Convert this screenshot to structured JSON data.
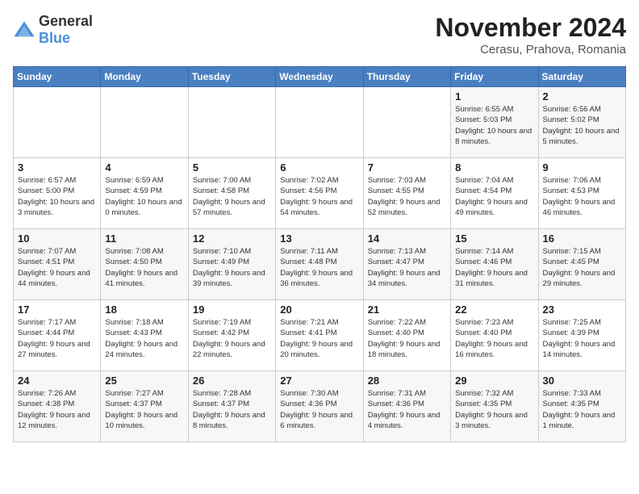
{
  "logo": {
    "general": "General",
    "blue": "Blue"
  },
  "title": {
    "month_year": "November 2024",
    "location": "Cerasu, Prahova, Romania"
  },
  "days_of_week": [
    "Sunday",
    "Monday",
    "Tuesday",
    "Wednesday",
    "Thursday",
    "Friday",
    "Saturday"
  ],
  "weeks": [
    [
      {
        "day": "",
        "info": ""
      },
      {
        "day": "",
        "info": ""
      },
      {
        "day": "",
        "info": ""
      },
      {
        "day": "",
        "info": ""
      },
      {
        "day": "",
        "info": ""
      },
      {
        "day": "1",
        "info": "Sunrise: 6:55 AM\nSunset: 5:03 PM\nDaylight: 10 hours and 8 minutes."
      },
      {
        "day": "2",
        "info": "Sunrise: 6:56 AM\nSunset: 5:02 PM\nDaylight: 10 hours and 5 minutes."
      }
    ],
    [
      {
        "day": "3",
        "info": "Sunrise: 6:57 AM\nSunset: 5:00 PM\nDaylight: 10 hours and 3 minutes."
      },
      {
        "day": "4",
        "info": "Sunrise: 6:59 AM\nSunset: 4:59 PM\nDaylight: 10 hours and 0 minutes."
      },
      {
        "day": "5",
        "info": "Sunrise: 7:00 AM\nSunset: 4:58 PM\nDaylight: 9 hours and 57 minutes."
      },
      {
        "day": "6",
        "info": "Sunrise: 7:02 AM\nSunset: 4:56 PM\nDaylight: 9 hours and 54 minutes."
      },
      {
        "day": "7",
        "info": "Sunrise: 7:03 AM\nSunset: 4:55 PM\nDaylight: 9 hours and 52 minutes."
      },
      {
        "day": "8",
        "info": "Sunrise: 7:04 AM\nSunset: 4:54 PM\nDaylight: 9 hours and 49 minutes."
      },
      {
        "day": "9",
        "info": "Sunrise: 7:06 AM\nSunset: 4:53 PM\nDaylight: 9 hours and 46 minutes."
      }
    ],
    [
      {
        "day": "10",
        "info": "Sunrise: 7:07 AM\nSunset: 4:51 PM\nDaylight: 9 hours and 44 minutes."
      },
      {
        "day": "11",
        "info": "Sunrise: 7:08 AM\nSunset: 4:50 PM\nDaylight: 9 hours and 41 minutes."
      },
      {
        "day": "12",
        "info": "Sunrise: 7:10 AM\nSunset: 4:49 PM\nDaylight: 9 hours and 39 minutes."
      },
      {
        "day": "13",
        "info": "Sunrise: 7:11 AM\nSunset: 4:48 PM\nDaylight: 9 hours and 36 minutes."
      },
      {
        "day": "14",
        "info": "Sunrise: 7:13 AM\nSunset: 4:47 PM\nDaylight: 9 hours and 34 minutes."
      },
      {
        "day": "15",
        "info": "Sunrise: 7:14 AM\nSunset: 4:46 PM\nDaylight: 9 hours and 31 minutes."
      },
      {
        "day": "16",
        "info": "Sunrise: 7:15 AM\nSunset: 4:45 PM\nDaylight: 9 hours and 29 minutes."
      }
    ],
    [
      {
        "day": "17",
        "info": "Sunrise: 7:17 AM\nSunset: 4:44 PM\nDaylight: 9 hours and 27 minutes."
      },
      {
        "day": "18",
        "info": "Sunrise: 7:18 AM\nSunset: 4:43 PM\nDaylight: 9 hours and 24 minutes."
      },
      {
        "day": "19",
        "info": "Sunrise: 7:19 AM\nSunset: 4:42 PM\nDaylight: 9 hours and 22 minutes."
      },
      {
        "day": "20",
        "info": "Sunrise: 7:21 AM\nSunset: 4:41 PM\nDaylight: 9 hours and 20 minutes."
      },
      {
        "day": "21",
        "info": "Sunrise: 7:22 AM\nSunset: 4:40 PM\nDaylight: 9 hours and 18 minutes."
      },
      {
        "day": "22",
        "info": "Sunrise: 7:23 AM\nSunset: 4:40 PM\nDaylight: 9 hours and 16 minutes."
      },
      {
        "day": "23",
        "info": "Sunrise: 7:25 AM\nSunset: 4:39 PM\nDaylight: 9 hours and 14 minutes."
      }
    ],
    [
      {
        "day": "24",
        "info": "Sunrise: 7:26 AM\nSunset: 4:38 PM\nDaylight: 9 hours and 12 minutes."
      },
      {
        "day": "25",
        "info": "Sunrise: 7:27 AM\nSunset: 4:37 PM\nDaylight: 9 hours and 10 minutes."
      },
      {
        "day": "26",
        "info": "Sunrise: 7:28 AM\nSunset: 4:37 PM\nDaylight: 9 hours and 8 minutes."
      },
      {
        "day": "27",
        "info": "Sunrise: 7:30 AM\nSunset: 4:36 PM\nDaylight: 9 hours and 6 minutes."
      },
      {
        "day": "28",
        "info": "Sunrise: 7:31 AM\nSunset: 4:36 PM\nDaylight: 9 hours and 4 minutes."
      },
      {
        "day": "29",
        "info": "Sunrise: 7:32 AM\nSunset: 4:35 PM\nDaylight: 9 hours and 3 minutes."
      },
      {
        "day": "30",
        "info": "Sunrise: 7:33 AM\nSunset: 4:35 PM\nDaylight: 9 hours and 1 minute."
      }
    ]
  ]
}
